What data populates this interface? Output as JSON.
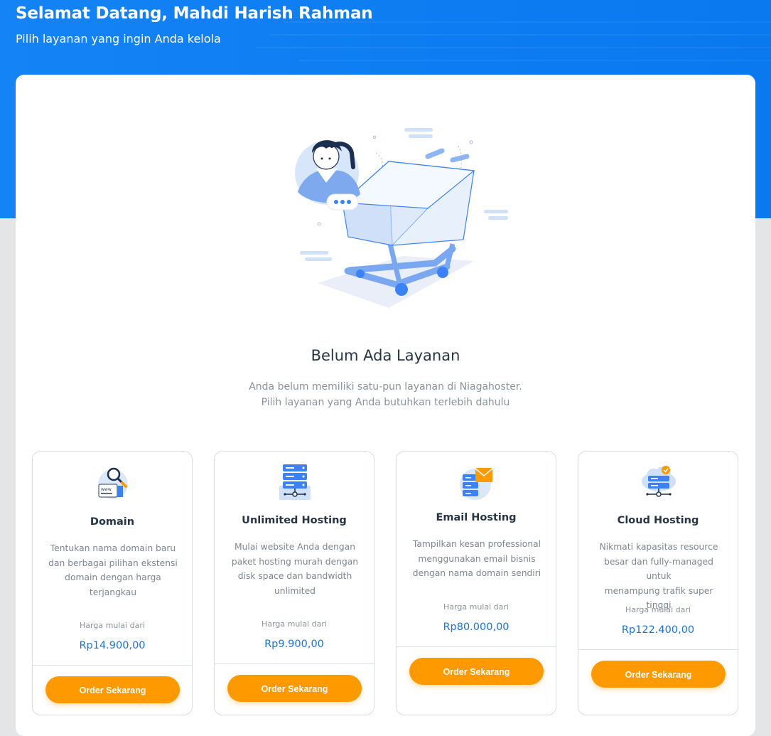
{
  "header": {
    "welcome_title": "Selamat Datang, Mahdi Harish Rahman",
    "subtitle": "Pilih layanan yang ingin Anda kelola"
  },
  "empty_state": {
    "title": "Belum Ada Layanan",
    "description_line1": "Anda belum memiliki satu-pun layanan di Niagahoster.",
    "description_line2": "Pilih layanan yang Anda butuhkan terlebih dahulu"
  },
  "services": [
    {
      "title": "Domain",
      "icon": "domain-search-icon",
      "desc": [
        "Tentukan nama domain baru",
        "dan berbagai pilihan ekstensi",
        "domain dengan harga",
        "terjangkau"
      ],
      "price_label": "Harga mulai dari",
      "price": "Rp14.900,00",
      "button": "Order Sekarang"
    },
    {
      "title": "Unlimited Hosting",
      "icon": "server-icon",
      "desc": [
        "Mulai website Anda dengan",
        "paket hosting murah dengan",
        "disk space dan bandwidth",
        "unlimited"
      ],
      "price_label": "Harga mulai dari",
      "price": "Rp9.900,00",
      "button": "Order Sekarang"
    },
    {
      "title": "Email Hosting",
      "icon": "email-server-icon",
      "desc": [
        "Tampilkan kesan professional",
        "menggunakan email bisnis",
        "dengan nama domain sendiri"
      ],
      "price_label": "Harga mulai dari",
      "price": "Rp80.000,00",
      "button": "Order Sekarang"
    },
    {
      "title": "Cloud Hosting",
      "icon": "cloud-server-icon",
      "desc": [
        "Nikmati kapasitas resource",
        "besar dan fully-managed untuk",
        "menampung trafik super tinggi"
      ],
      "price_label": "Harga mulai dari",
      "price": "Rp122.400,00",
      "button": "Order Sekarang"
    }
  ],
  "colors": {
    "brand_blue": "#0d7cf2",
    "accent_orange": "#ff9900",
    "price_blue": "#1a74d6"
  },
  "illustration": "empty-shopping-cart-illustration"
}
